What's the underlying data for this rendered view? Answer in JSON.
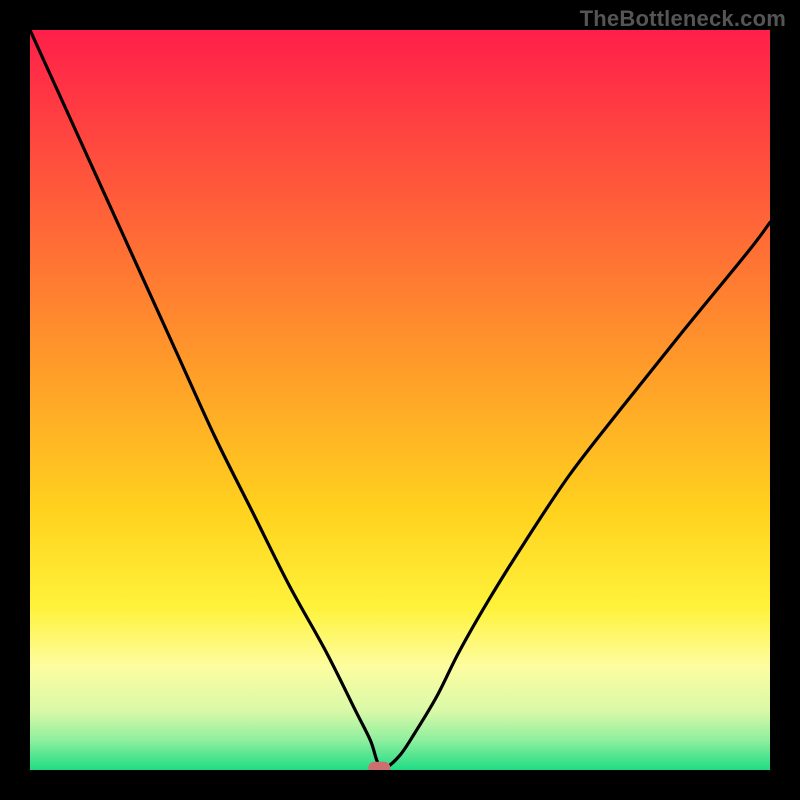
{
  "watermark": "TheBottleneck.com",
  "chart_data": {
    "type": "line",
    "title": "",
    "xlabel": "",
    "ylabel": "",
    "xlim": [
      0,
      100
    ],
    "ylim": [
      0,
      100
    ],
    "grid": false,
    "legend": false,
    "series": [
      {
        "name": "bottleneck-curve",
        "x": [
          0,
          5,
          10,
          15,
          20,
          25,
          30,
          35,
          40,
          44,
          46,
          47,
          48,
          50,
          52,
          55,
          58,
          62,
          67,
          73,
          80,
          88,
          97,
          100
        ],
        "y": [
          100,
          89,
          78,
          67,
          56,
          45,
          35,
          25,
          16,
          8,
          4,
          1,
          0.3,
          2,
          5,
          10,
          16,
          23,
          31,
          40,
          49,
          59,
          70,
          74
        ]
      }
    ],
    "marker": {
      "x": 47.2,
      "y": 0.3,
      "shape": "capsule",
      "color": "#cd6f6f"
    },
    "background_gradient": {
      "stops": [
        {
          "offset": 0.0,
          "color": "#ff1f4a"
        },
        {
          "offset": 0.22,
          "color": "#ff5a3a"
        },
        {
          "offset": 0.45,
          "color": "#ff9a2a"
        },
        {
          "offset": 0.65,
          "color": "#ffd21e"
        },
        {
          "offset": 0.78,
          "color": "#fff23a"
        },
        {
          "offset": 0.86,
          "color": "#fdfda0"
        },
        {
          "offset": 0.92,
          "color": "#d9f9a8"
        },
        {
          "offset": 0.96,
          "color": "#8eef9e"
        },
        {
          "offset": 1.0,
          "color": "#1fdc84"
        }
      ]
    },
    "colors": {
      "curve": "#000000",
      "marker": "#cd6f6f",
      "frame": "#000000"
    }
  }
}
